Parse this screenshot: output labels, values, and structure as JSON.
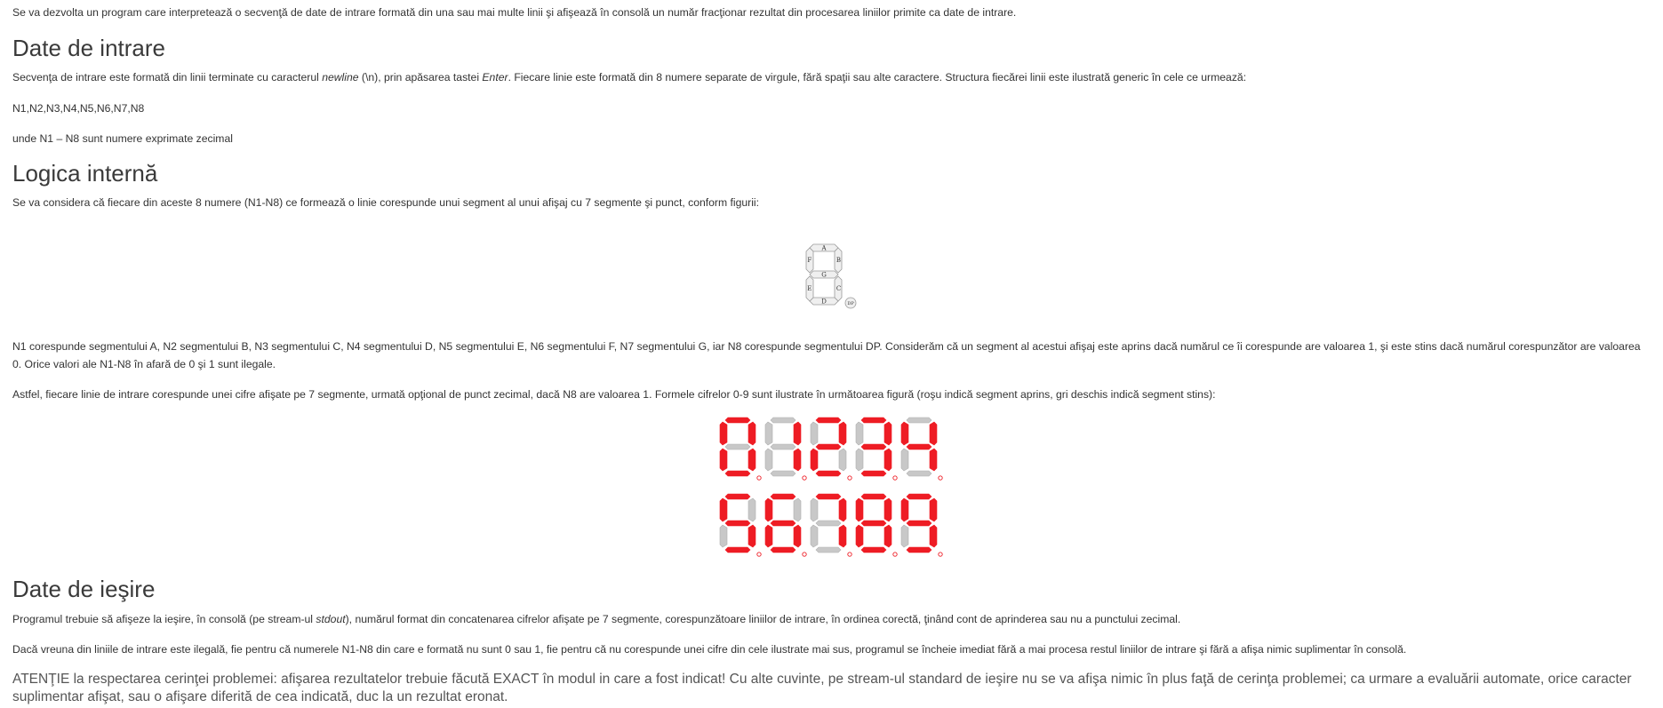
{
  "intro": {
    "text": "Se va dezvolta un program care interpretează o secvenţă de date de intrare formată din una sau mai multe linii şi afişează în consolă un număr fracţionar rezultat din procesarea liniilor primite ca date de intrare."
  },
  "input_section": {
    "heading": "Date de intrare",
    "p1_before_newline": "Secvenţa de intrare este formată din linii terminate cu caracterul ",
    "p1_newline": "newline",
    "p1_middle": " (\\n), prin apăsarea tastei ",
    "p1_enter": "Enter",
    "p1_after": ". Fiecare linie este formată din 8 numere separate de virgule, fără spaţii sau alte caractere. Structura fiecărei linii este ilustrată generic în cele ce urmează:",
    "format_line": "N1,N2,N3,N4,N5,N6,N7,N8",
    "where_line": "unde N1 – N8 sunt numere exprimate zecimal"
  },
  "logic_section": {
    "heading": "Logica internă",
    "p1": "Se va considera că fiecare din aceste 8 numere (N1-N8) ce formează o linie corespunde unui segment al unui afişaj cu 7 segmente şi punct, conform figurii:",
    "segment_labels": {
      "a": "A",
      "b": "B",
      "c": "C",
      "d": "D",
      "e": "E",
      "f": "F",
      "g": "G",
      "dp": "DP"
    },
    "p2": "N1 corespunde segmentului A, N2 segmentului B, N3 segmentului C, N4 segmentului D, N5 segmentului E, N6 segmentului F, N7 segmentului G, iar N8 corespunde segmentului DP. Considerăm că un segment al acestui afişaj este aprins dacă numărul ce îi corespunde are valoarea 1, şi este stins dacă numărul corespunzător are valoarea 0. Orice valori ale N1-N8 în afară de 0 şi 1 sunt ilegale.",
    "p3": "Astfel, fiecare linie de intrare corespunde unei cifre afişate pe 7 segmente, urmată opţional de punct zecimal, dacă N8 are valoarea 1. Formele cifrelor 0-9 sunt ilustrate în următoarea figură (roşu indică segment aprins, gri deschis indică segment stins):",
    "digits": [
      "0",
      "1",
      "2",
      "3",
      "4",
      "5",
      "6",
      "7",
      "8",
      "9"
    ],
    "colors": {
      "on": "#ee1c24",
      "off": "#c8c8c8",
      "outline": "#b0b0b0"
    }
  },
  "output_section": {
    "heading": "Date de ieşire",
    "p1_before": "Programul trebuie să afişeze la ieşire, în consolă (pe stream-ul ",
    "p1_stdout": "stdout",
    "p1_after": "), numărul format din concatenarea cifrelor afişate pe 7 segmente, corespunzătoare liniilor de intrare, în ordinea corectă, ţinând cont de aprinderea sau nu a punctului zecimal.",
    "p2": "Dacă vreuna din liniile de intrare este ilegală, fie pentru că numerele N1-N8 din care e formată nu sunt 0 sau 1, fie pentru că nu corespunde unei cifre din cele ilustrate mai sus, programul se încheie imediat fără a mai procesa restul liniilor de intrare şi fără a afişa nimic suplimentar în consolă.",
    "attention": "ATENŢIE la respectarea cerinţei problemei: afişarea rezultatelor trebuie făcută EXACT în modul in care a fost indicat! Cu alte cuvinte, pe stream-ul standard de ieşire nu se va afişa nimic în plus faţă de cerinţa problemei; ca urmare a evaluării automate, orice caracter suplimentar afişat, sau o afişare diferită de cea indicată, duc la un rezultat eronat."
  }
}
